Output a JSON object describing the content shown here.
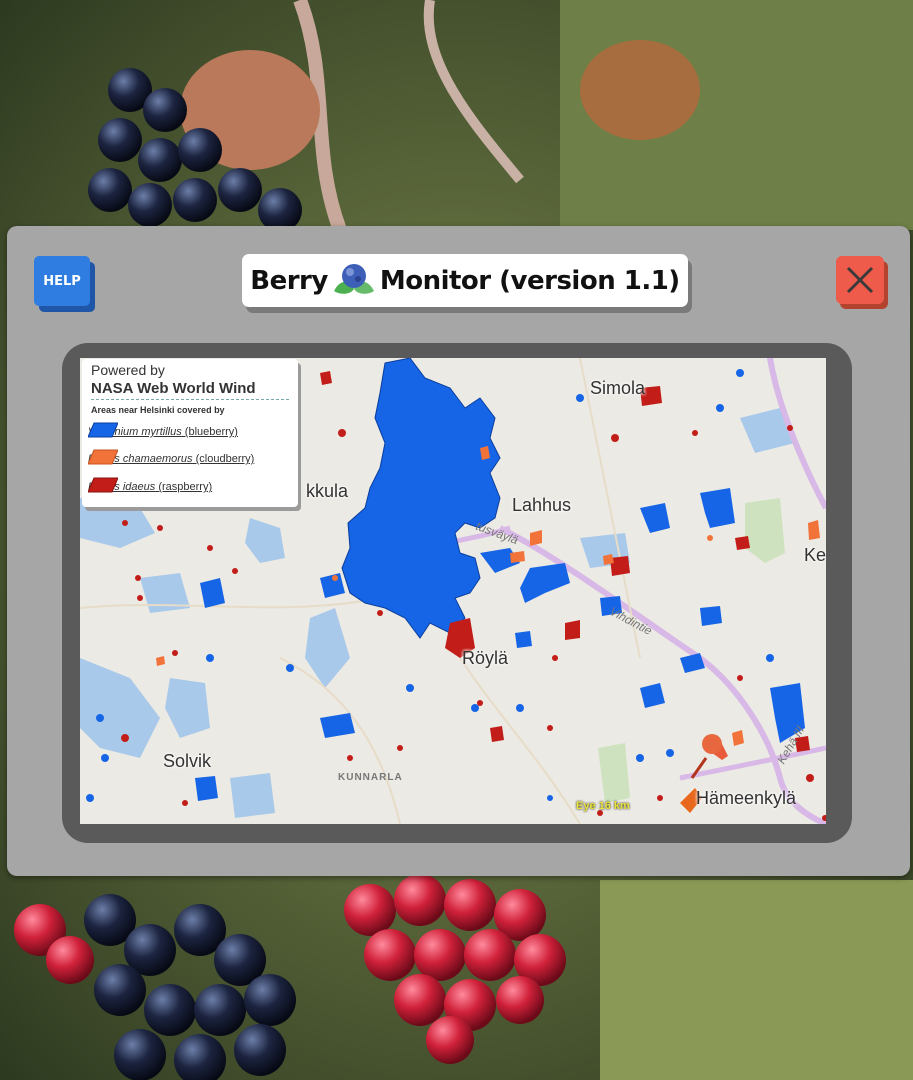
{
  "help_button": {
    "label": "HELP"
  },
  "title": {
    "left": "Berry",
    "right": "Monitor (version 1.1)"
  },
  "close_button": {
    "icon": "close-icon"
  },
  "legend": {
    "powered_by": "Powered by",
    "provider": "NASA Web World Wind",
    "areas_heading": "Areas near Helsinki covered by",
    "items": [
      {
        "species": "Vaccinium myrtillus",
        "common": " (blueberry)",
        "color": "#1565e6"
      },
      {
        "species": "Rubus chamaemorus",
        "common": " (cloudberry)",
        "color": "#f2733a"
      },
      {
        "species": "Rubus idaeus",
        "common": " (raspberry)",
        "color": "#c21d18"
      }
    ]
  },
  "map": {
    "places": [
      "Simola",
      "kkula",
      "Lahhus",
      "Röylä",
      "Solvik",
      "KUNNARLA",
      "Hämeenkylä",
      "Ke"
    ],
    "roads": [
      "Vihdintie",
      "Kehä III",
      "tusväylä"
    ],
    "eye_readout": "Eye  16 km"
  },
  "colors": {
    "blueberry": "#1565e6",
    "cloudberry": "#f2733a",
    "raspberry": "#c21d18",
    "panel": "#a6a6a6",
    "help": "#2f7de0",
    "close": "#ef5b4a"
  }
}
